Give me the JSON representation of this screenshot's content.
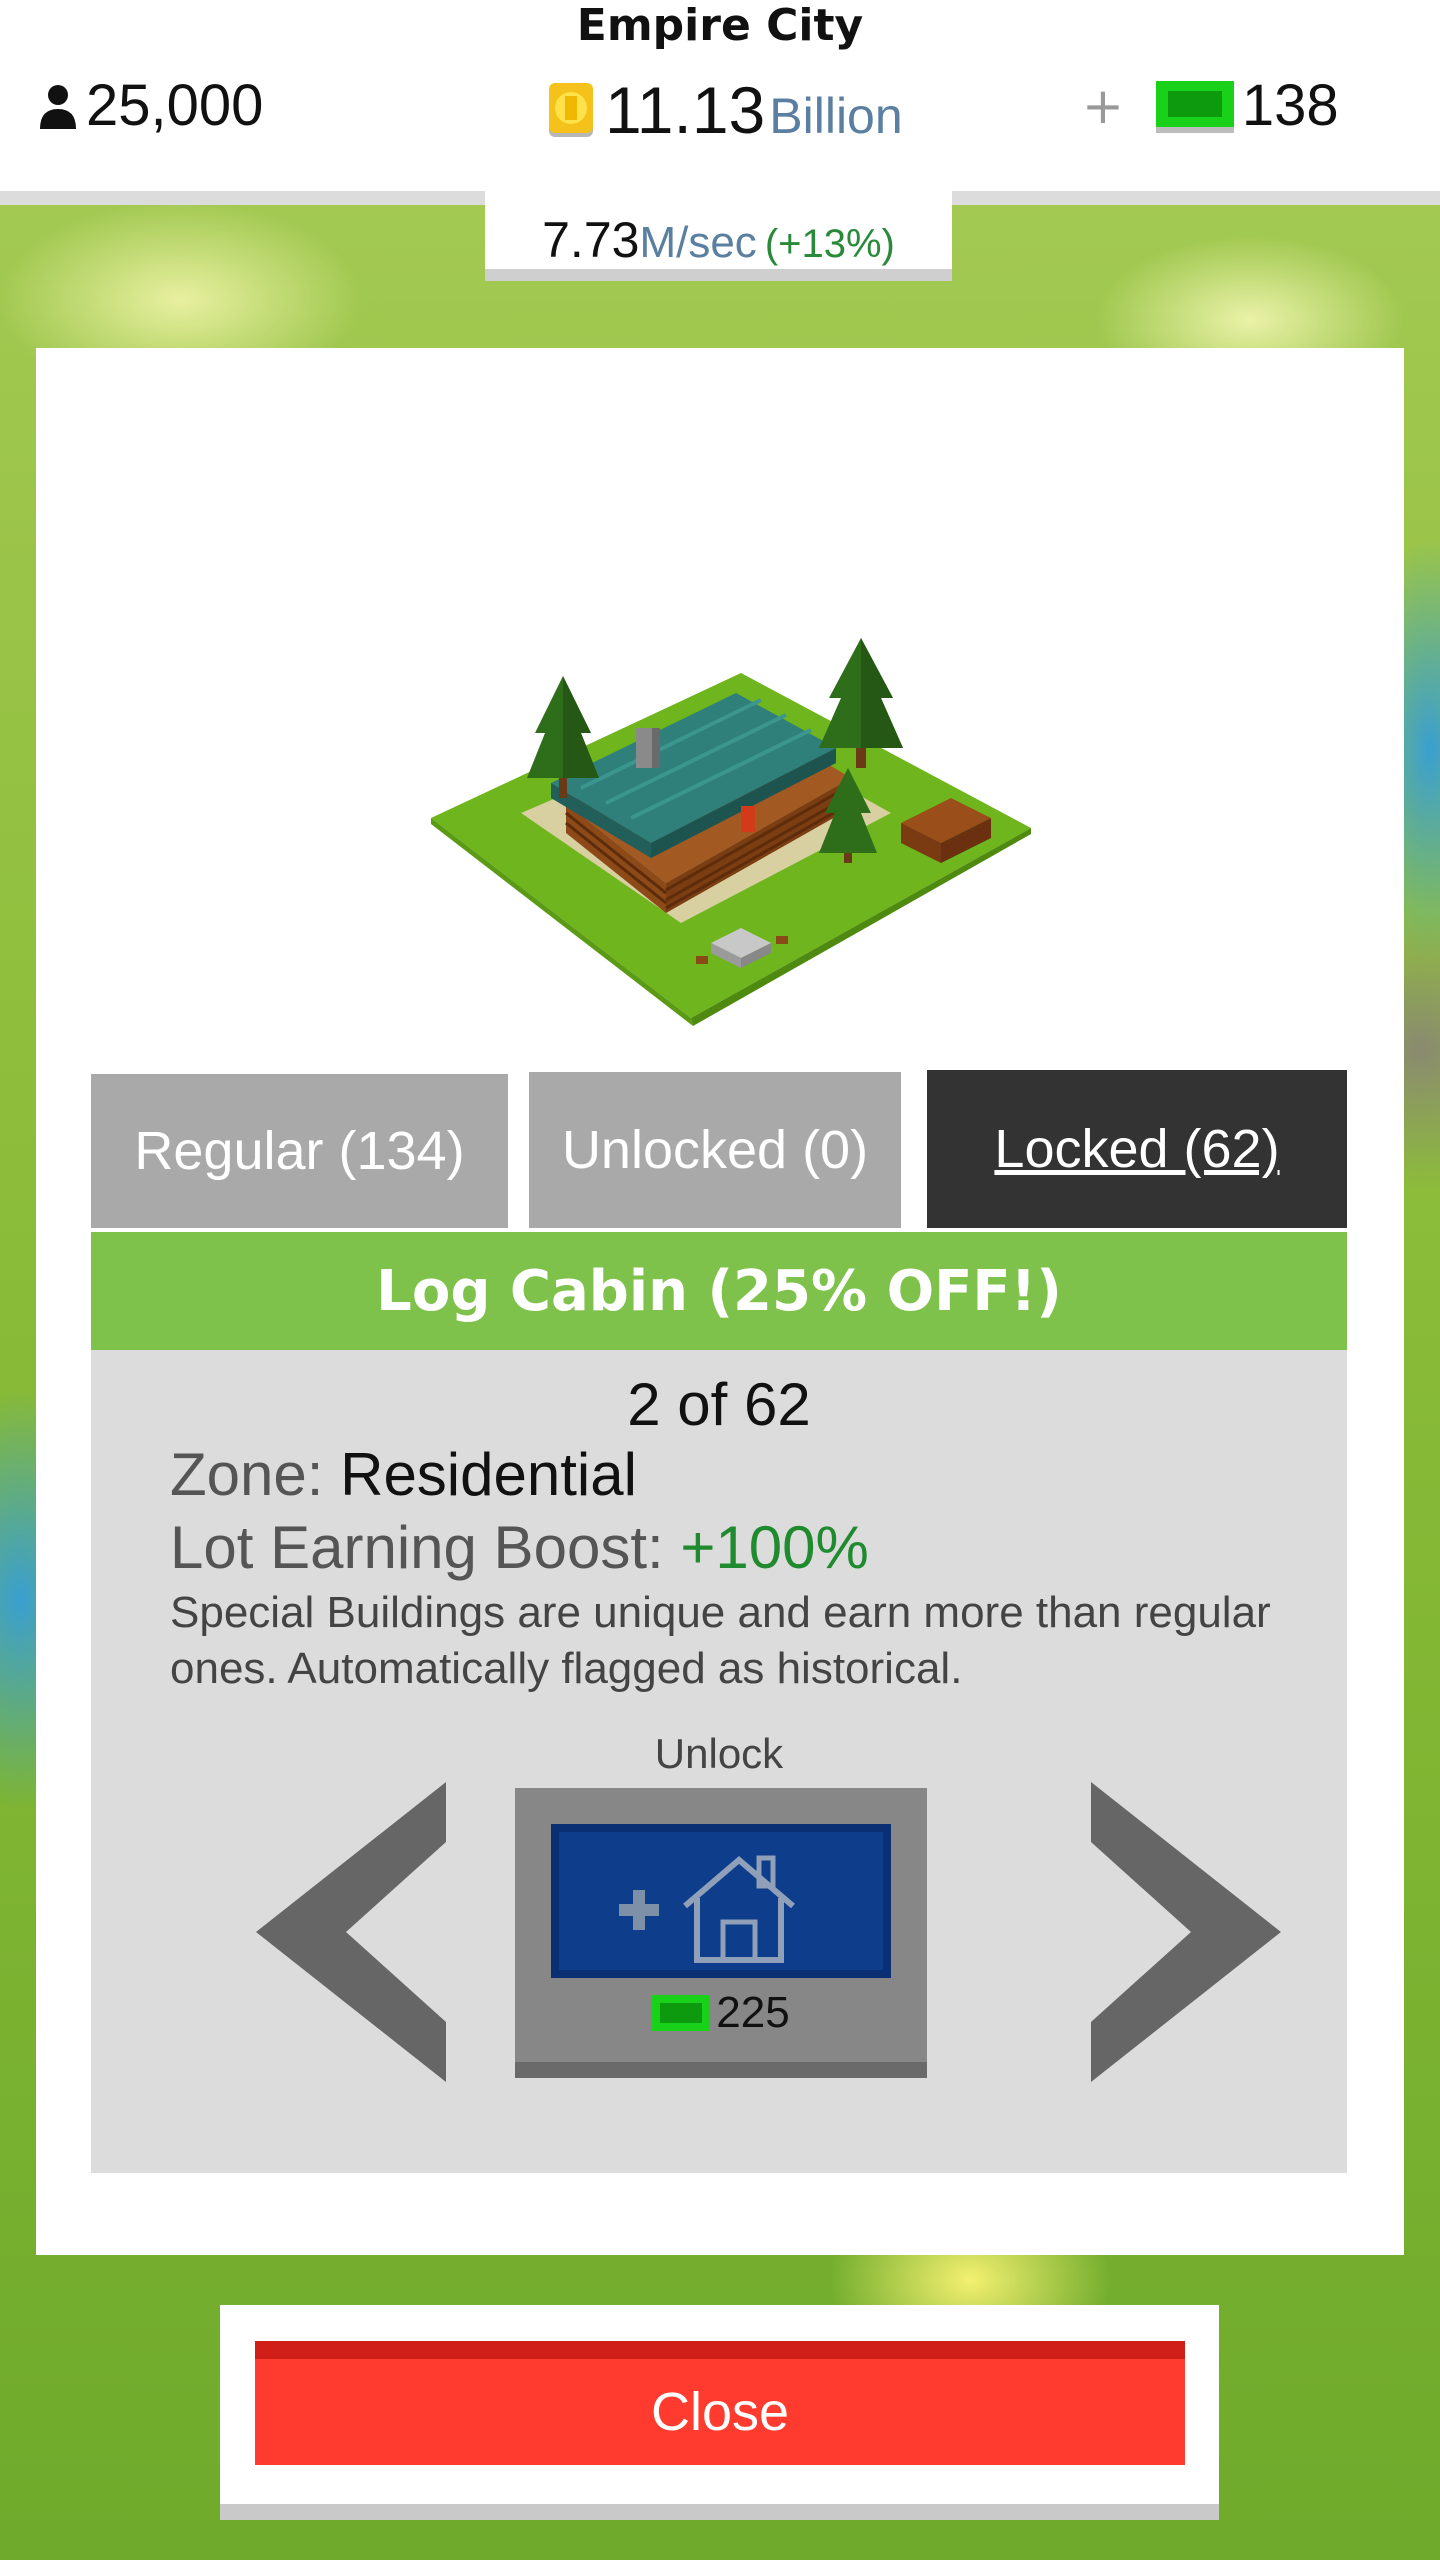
{
  "header": {
    "city_name": "Empire City",
    "population": "25,000",
    "money_value": "11.13",
    "money_unit": "Billion",
    "cash_plus": "+",
    "cash_value": "138",
    "rate_value": "7.73",
    "rate_unit": "M/sec",
    "rate_pct": "(+13%)"
  },
  "tabs": [
    {
      "label": "Regular (134)",
      "active": false
    },
    {
      "label": "Unlocked (0)",
      "active": false
    },
    {
      "label": "Locked (62)",
      "active": true
    }
  ],
  "building": {
    "title": "Log Cabin (25% OFF!)",
    "counter": "2 of 62",
    "zone_label": "Zone:",
    "zone_value": "Residential",
    "boost_label": "Lot Earning Boost:",
    "boost_value": "+100%",
    "description": "Special Buildings are unique and earn more than regular ones. Automatically flagged as historical."
  },
  "unlock": {
    "label": "Unlock",
    "price": "225"
  },
  "close_label": "Close",
  "icons": {
    "population": "person-icon",
    "money": "coin-icon",
    "cash": "cash-icon",
    "prev": "chevron-left-icon",
    "next": "chevron-right-icon",
    "build": "add-house-icon"
  },
  "colors": {
    "title_bar": "#7fc24b",
    "active_tab": "#333333",
    "inactive_tab": "#a9a9a9",
    "close_button": "#ff3a2e",
    "unlock_inner": "#0e3d8c",
    "boost_green": "#1f8a2e"
  }
}
